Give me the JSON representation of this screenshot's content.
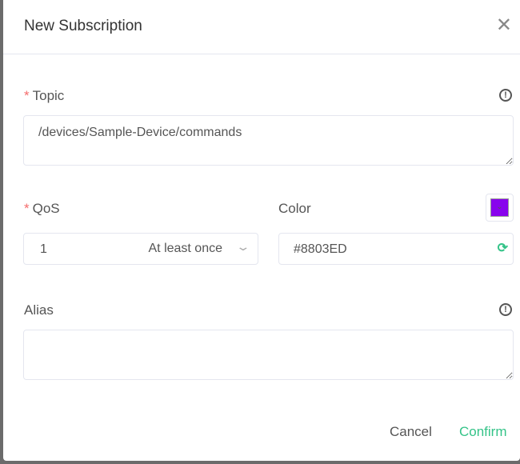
{
  "dialog": {
    "title": "New Subscription"
  },
  "topic": {
    "label": "Topic",
    "value": "/devices/Sample-Device/commands"
  },
  "qos": {
    "label": "QoS",
    "value": "1",
    "description": "At least once"
  },
  "color": {
    "label": "Color",
    "value": "#8803ED",
    "swatch": "#8803ED",
    "accent": "#34c388"
  },
  "alias": {
    "label": "Alias",
    "value": ""
  },
  "buttons": {
    "cancel": "Cancel",
    "confirm": "Confirm"
  }
}
